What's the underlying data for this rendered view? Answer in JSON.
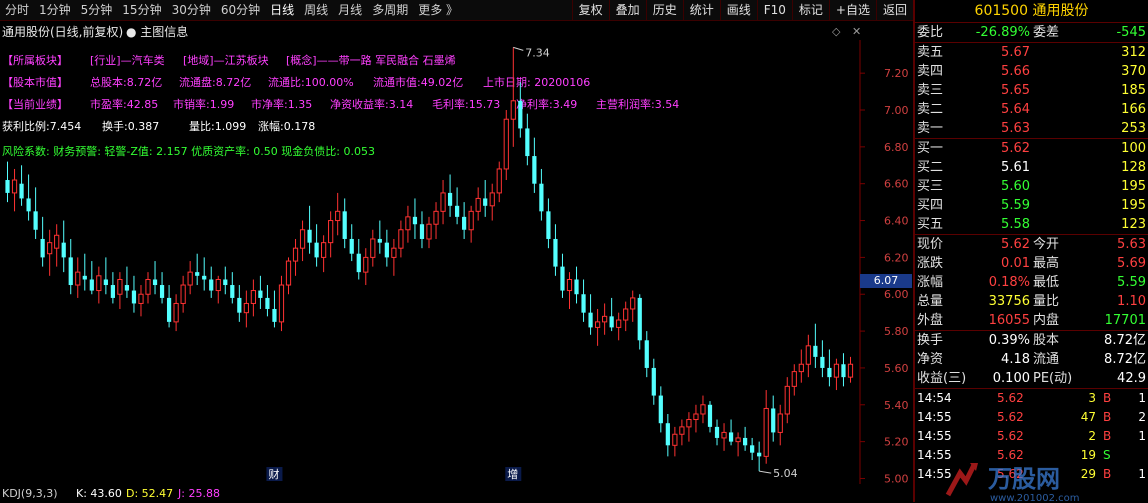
{
  "toolbar": {
    "periods": [
      "分时",
      "1分钟",
      "5分钟",
      "15分钟",
      "30分钟",
      "60分钟",
      "日线",
      "周线",
      "月线",
      "多周期",
      "更多 》"
    ],
    "active_period": "日线",
    "buttons": [
      "复权",
      "叠加",
      "历史",
      "统计",
      "画线",
      "F10",
      "标记",
      "+自选",
      "返回"
    ]
  },
  "title": {
    "stock": "通用股份(日线,前复权)",
    "main_indicator": "主图信息"
  },
  "info": {
    "sector_label": "【所属板块】",
    "industry": "[行业]—汽车类",
    "region": "[地域]—江苏板块",
    "concept": "[概念]——带一路 军民融合 石墨烯",
    "equity_label": "【股本市值】",
    "total_shares": "总股本:8.72亿",
    "float_shares": "流通盘:8.72亿",
    "float_ratio": "流通比:100.00%",
    "float_value": "流通市值:49.02亿",
    "listing_date": "上市日期: 20200106",
    "perf_label": "【当前业绩】",
    "pe": "市盈率:42.85",
    "ps": "市销率:1.99",
    "pb": "市净率:1.35",
    "roe": "净资收益率:3.14",
    "gross_margin": "毛利率:15.73",
    "net_margin": "净利率:3.49",
    "main_margin": "主营利润率:3.54",
    "profit_ratio": "获利比例:7.454",
    "turnover": "换手:0.387",
    "volume_ratio": "量比:1.099",
    "change": "涨幅:0.178",
    "risk": "风险系数: 财务预警: 轻警-Z值: 2.157 优质资产率: 0.50 现金负债比: 0.053"
  },
  "kdj": {
    "label": "KDJ(9,3,3)",
    "k": "K: 43.60",
    "d": "D: 52.47",
    "j": "J: 25.88"
  },
  "chart_data": {
    "type": "candlestick",
    "y_ticks": [
      "7.20",
      "7.00",
      "6.80",
      "6.60",
      "6.40",
      "6.20",
      "6.00",
      "5.80",
      "5.60",
      "5.40",
      "5.20",
      "5.00"
    ],
    "ylim": [
      4.97,
      7.38
    ],
    "current_price_marker": "6.07",
    "high_annotation": "7.34",
    "low_annotation": "5.04",
    "event_markers": [
      "财",
      "增"
    ],
    "ohlc": [
      [
        6.62,
        6.72,
        6.5,
        6.55
      ],
      [
        6.55,
        6.68,
        6.45,
        6.62
      ],
      [
        6.6,
        6.7,
        6.48,
        6.52
      ],
      [
        6.52,
        6.65,
        6.4,
        6.45
      ],
      [
        6.45,
        6.58,
        6.3,
        6.35
      ],
      [
        6.3,
        6.42,
        6.15,
        6.2
      ],
      [
        6.22,
        6.35,
        6.1,
        6.28
      ],
      [
        6.25,
        6.38,
        6.15,
        6.32
      ],
      [
        6.28,
        6.4,
        6.12,
        6.2
      ],
      [
        6.2,
        6.3,
        6.0,
        6.05
      ],
      [
        6.05,
        6.2,
        5.98,
        6.12
      ],
      [
        6.1,
        6.22,
        6.02,
        6.08
      ],
      [
        6.08,
        6.18,
        6.0,
        6.02
      ],
      [
        6.02,
        6.15,
        5.95,
        6.1
      ],
      [
        6.08,
        6.2,
        6.0,
        6.05
      ],
      [
        6.05,
        6.12,
        5.95,
        5.98
      ],
      [
        6.0,
        6.12,
        5.92,
        6.08
      ],
      [
        6.05,
        6.15,
        5.98,
        6.02
      ],
      [
        6.02,
        6.1,
        5.9,
        5.95
      ],
      [
        5.95,
        6.05,
        5.88,
        6.0
      ],
      [
        6.0,
        6.12,
        5.95,
        6.08
      ],
      [
        6.08,
        6.18,
        6.0,
        6.05
      ],
      [
        6.05,
        6.12,
        5.95,
        5.98
      ],
      [
        5.98,
        6.05,
        5.82,
        5.85
      ],
      [
        5.85,
        6.0,
        5.8,
        5.95
      ],
      [
        5.95,
        6.1,
        5.9,
        6.05
      ],
      [
        6.05,
        6.18,
        6.0,
        6.12
      ],
      [
        6.12,
        6.22,
        6.05,
        6.1
      ],
      [
        6.1,
        6.2,
        6.02,
        6.08
      ],
      [
        6.08,
        6.15,
        5.98,
        6.02
      ],
      [
        6.02,
        6.1,
        5.95,
        6.08
      ],
      [
        6.08,
        6.15,
        6.0,
        6.05
      ],
      [
        6.05,
        6.12,
        5.95,
        5.98
      ],
      [
        5.98,
        6.05,
        5.85,
        5.9
      ],
      [
        5.9,
        6.02,
        5.82,
        5.95
      ],
      [
        5.95,
        6.08,
        5.88,
        6.02
      ],
      [
        6.02,
        6.1,
        5.92,
        5.98
      ],
      [
        5.98,
        6.05,
        5.88,
        5.92
      ],
      [
        5.92,
        6.02,
        5.82,
        5.85
      ],
      [
        5.85,
        6.1,
        5.8,
        6.05
      ],
      [
        6.05,
        6.2,
        6.0,
        6.18
      ],
      [
        6.18,
        6.3,
        6.1,
        6.25
      ],
      [
        6.25,
        6.4,
        6.18,
        6.35
      ],
      [
        6.35,
        6.48,
        6.22,
        6.28
      ],
      [
        6.28,
        6.38,
        6.15,
        6.2
      ],
      [
        6.2,
        6.32,
        6.12,
        6.28
      ],
      [
        6.28,
        6.45,
        6.2,
        6.4
      ],
      [
        6.4,
        6.55,
        6.32,
        6.45
      ],
      [
        6.45,
        6.52,
        6.25,
        6.3
      ],
      [
        6.3,
        6.38,
        6.18,
        6.22
      ],
      [
        6.22,
        6.3,
        6.08,
        6.12
      ],
      [
        6.12,
        6.25,
        6.05,
        6.2
      ],
      [
        6.2,
        6.35,
        6.15,
        6.3
      ],
      [
        6.3,
        6.4,
        6.22,
        6.28
      ],
      [
        6.28,
        6.35,
        6.15,
        6.2
      ],
      [
        6.2,
        6.3,
        6.1,
        6.25
      ],
      [
        6.25,
        6.4,
        6.2,
        6.35
      ],
      [
        6.35,
        6.48,
        6.28,
        6.42
      ],
      [
        6.42,
        6.52,
        6.3,
        6.38
      ],
      [
        6.38,
        6.45,
        6.25,
        6.3
      ],
      [
        6.3,
        6.42,
        6.25,
        6.38
      ],
      [
        6.38,
        6.5,
        6.3,
        6.45
      ],
      [
        6.45,
        6.62,
        6.38,
        6.55
      ],
      [
        6.55,
        6.65,
        6.42,
        6.48
      ],
      [
        6.48,
        6.58,
        6.38,
        6.42
      ],
      [
        6.42,
        6.5,
        6.3,
        6.35
      ],
      [
        6.35,
        6.48,
        6.28,
        6.45
      ],
      [
        6.45,
        6.58,
        6.4,
        6.52
      ],
      [
        6.52,
        6.62,
        6.42,
        6.48
      ],
      [
        6.48,
        6.6,
        6.4,
        6.55
      ],
      [
        6.55,
        6.72,
        6.5,
        6.68
      ],
      [
        6.68,
        7.0,
        6.62,
        6.95
      ],
      [
        6.95,
        7.34,
        6.8,
        7.05
      ],
      [
        7.05,
        7.15,
        6.85,
        6.9
      ],
      [
        6.9,
        6.98,
        6.7,
        6.75
      ],
      [
        6.75,
        6.85,
        6.55,
        6.6
      ],
      [
        6.6,
        6.68,
        6.4,
        6.45
      ],
      [
        6.45,
        6.52,
        6.25,
        6.3
      ],
      [
        6.3,
        6.38,
        6.1,
        6.15
      ],
      [
        6.15,
        6.22,
        5.98,
        6.02
      ],
      [
        6.02,
        6.12,
        5.92,
        6.08
      ],
      [
        6.08,
        6.15,
        5.95,
        6.0
      ],
      [
        6.0,
        6.08,
        5.85,
        5.9
      ],
      [
        5.9,
        6.0,
        5.78,
        5.82
      ],
      [
        5.82,
        5.92,
        5.72,
        5.85
      ],
      [
        5.85,
        5.95,
        5.78,
        5.88
      ],
      [
        5.88,
        5.98,
        5.8,
        5.82
      ],
      [
        5.82,
        5.9,
        5.75,
        5.86
      ],
      [
        5.86,
        5.96,
        5.8,
        5.92
      ],
      [
        5.92,
        6.02,
        5.85,
        5.98
      ],
      [
        5.98,
        6.0,
        5.7,
        5.75
      ],
      [
        5.75,
        5.8,
        5.55,
        5.6
      ],
      [
        5.6,
        5.65,
        5.4,
        5.45
      ],
      [
        5.45,
        5.5,
        5.25,
        5.3
      ],
      [
        5.3,
        5.35,
        5.12,
        5.18
      ],
      [
        5.18,
        5.28,
        5.12,
        5.24
      ],
      [
        5.24,
        5.32,
        5.18,
        5.28
      ],
      [
        5.28,
        5.36,
        5.2,
        5.32
      ],
      [
        5.32,
        5.4,
        5.25,
        5.35
      ],
      [
        5.35,
        5.45,
        5.3,
        5.4
      ],
      [
        5.4,
        5.42,
        5.25,
        5.28
      ],
      [
        5.28,
        5.32,
        5.18,
        5.22
      ],
      [
        5.22,
        5.3,
        5.15,
        5.25
      ],
      [
        5.25,
        5.32,
        5.18,
        5.2
      ],
      [
        5.2,
        5.25,
        5.12,
        5.22
      ],
      [
        5.22,
        5.28,
        5.15,
        5.18
      ],
      [
        5.18,
        5.22,
        5.1,
        5.14
      ],
      [
        5.14,
        5.2,
        5.04,
        5.12
      ],
      [
        5.12,
        5.48,
        5.08,
        5.38
      ],
      [
        5.38,
        5.45,
        5.2,
        5.25
      ],
      [
        5.25,
        5.4,
        5.18,
        5.35
      ],
      [
        5.35,
        5.55,
        5.3,
        5.5
      ],
      [
        5.5,
        5.62,
        5.45,
        5.58
      ],
      [
        5.58,
        5.7,
        5.52,
        5.62
      ],
      [
        5.62,
        5.78,
        5.55,
        5.72
      ],
      [
        5.72,
        5.84,
        5.6,
        5.66
      ],
      [
        5.66,
        5.75,
        5.55,
        5.6
      ],
      [
        5.6,
        5.7,
        5.5,
        5.55
      ],
      [
        5.55,
        5.65,
        5.48,
        5.62
      ],
      [
        5.62,
        5.68,
        5.5,
        5.55
      ],
      [
        5.55,
        5.66,
        5.52,
        5.62
      ]
    ]
  },
  "panel": {
    "code_name": "601500 通用股份",
    "wb_label": "委比",
    "wb_value": "-26.89%",
    "wc_label": "委差",
    "wc_value": "-545",
    "sells": [
      {
        "label": "卖五",
        "price": "5.67",
        "vol": "312"
      },
      {
        "label": "卖四",
        "price": "5.66",
        "vol": "370"
      },
      {
        "label": "卖三",
        "price": "5.65",
        "vol": "185"
      },
      {
        "label": "卖二",
        "price": "5.64",
        "vol": "166"
      },
      {
        "label": "卖一",
        "price": "5.63",
        "vol": "253"
      }
    ],
    "buys": [
      {
        "label": "买一",
        "price": "5.62",
        "vol": "100"
      },
      {
        "label": "买二",
        "price": "5.61",
        "vol": "128"
      },
      {
        "label": "买三",
        "price": "5.60",
        "vol": "195"
      },
      {
        "label": "买四",
        "price": "5.59",
        "vol": "195"
      },
      {
        "label": "买五",
        "price": "5.58",
        "vol": "123"
      }
    ],
    "quote": [
      {
        "l1": "现价",
        "v1": "5.62",
        "l2": "今开",
        "v2": "5.63"
      },
      {
        "l1": "涨跌",
        "v1": "0.01",
        "l2": "最高",
        "v2": "5.69"
      },
      {
        "l1": "涨幅",
        "v1": "0.18%",
        "l2": "最低",
        "v2": "5.59"
      },
      {
        "l1": "总量",
        "v1": "33756",
        "l2": "量比",
        "v2": "1.10"
      },
      {
        "l1": "外盘",
        "v1": "16055",
        "l2": "内盘",
        "v2": "17701"
      }
    ],
    "stats": [
      {
        "l1": "换手",
        "v1": "0.39%",
        "l2": "股本",
        "v2": "8.72亿"
      },
      {
        "l1": "净资",
        "v1": "4.18",
        "l2": "流通",
        "v2": "8.72亿"
      },
      {
        "l1": "收益(三)",
        "v1": "0.100",
        "l2": "PE(动)",
        "v2": "42.9"
      }
    ],
    "ticks": [
      {
        "time": "14:54",
        "price": "5.62",
        "vol": "3",
        "side": "B",
        "n": "1"
      },
      {
        "time": "14:55",
        "price": "5.62",
        "vol": "47",
        "side": "B",
        "n": "2"
      },
      {
        "time": "14:55",
        "price": "5.62",
        "vol": "2",
        "side": "B",
        "n": "1"
      },
      {
        "time": "14:55",
        "price": "5.62",
        "vol": "19",
        "side": "S",
        "n": ""
      },
      {
        "time": "14:55",
        "price": "5.62",
        "vol": "29",
        "side": "B",
        "n": "1"
      }
    ],
    "watermark": "万股网",
    "watermark_url": "www.201002.com"
  }
}
